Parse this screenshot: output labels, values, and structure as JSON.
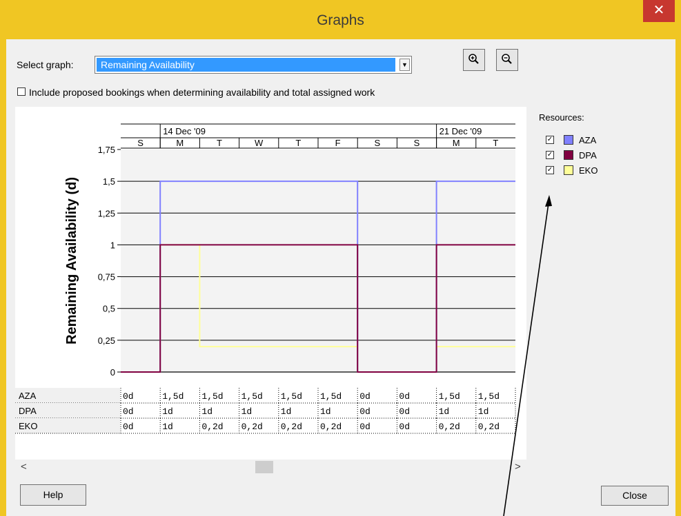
{
  "window": {
    "title": "Graphs",
    "close_glyph": "✕"
  },
  "toolbar": {
    "select_label": "Select graph:",
    "selected_graph": "Remaining Availability",
    "zoom_in_icon": "zoom-in-icon",
    "zoom_out_icon": "zoom-out-icon"
  },
  "options": {
    "include_proposed_label": "Include proposed bookings when determining availability and total assigned work",
    "include_proposed_checked": false
  },
  "timescale": {
    "weeks": [
      "14 Dec '09",
      "21 Dec '09"
    ],
    "days": [
      "S",
      "M",
      "T",
      "W",
      "T",
      "F",
      "S",
      "S",
      "M",
      "T"
    ]
  },
  "chart_data": {
    "type": "line",
    "ylabel": "Remaining Availability (d)",
    "yticks": [
      "1,75",
      "1,5",
      "1,25",
      "1",
      "0,75",
      "0,5",
      "0,25",
      "0"
    ],
    "ylim": [
      0,
      1.75
    ],
    "x": [
      "S",
      "M",
      "T",
      "W",
      "T",
      "F",
      "S",
      "S",
      "M",
      "T"
    ],
    "series": [
      {
        "name": "AZA",
        "color": "#8080ff",
        "values": [
          0,
          1.5,
          1.5,
          1.5,
          1.5,
          1.5,
          0,
          0,
          1.5,
          1.5
        ]
      },
      {
        "name": "DPA",
        "color": "#800040",
        "values": [
          0,
          1,
          1,
          1,
          1,
          1,
          0,
          0,
          1,
          1
        ]
      },
      {
        "name": "EKO",
        "color": "#ffff99",
        "values": [
          0,
          1,
          0.2,
          0.2,
          0.2,
          0.2,
          0,
          0,
          0.2,
          0.2
        ]
      }
    ]
  },
  "table": {
    "rows": [
      {
        "resource": "AZA",
        "cells": [
          "0d",
          "1,5d",
          "1,5d",
          "1,5d",
          "1,5d",
          "1,5d",
          "0d",
          "0d",
          "1,5d",
          "1,5d"
        ]
      },
      {
        "resource": "DPA",
        "cells": [
          "0d",
          "1d",
          "1d",
          "1d",
          "1d",
          "1d",
          "0d",
          "0d",
          "1d",
          "1d"
        ]
      },
      {
        "resource": "EKO",
        "cells": [
          "0d",
          "1d",
          "0,2d",
          "0,2d",
          "0,2d",
          "0,2d",
          "0d",
          "0d",
          "0,2d",
          "0,2d"
        ]
      }
    ]
  },
  "resources": {
    "heading": "Resources:",
    "items": [
      {
        "name": "AZA",
        "color": "#8080ff",
        "checked": true
      },
      {
        "name": "DPA",
        "color": "#800040",
        "checked": true
      },
      {
        "name": "EKO",
        "color": "#ffff99",
        "checked": true
      }
    ]
  },
  "scroll": {
    "left_glyph": "<",
    "right_glyph": ">"
  },
  "footer": {
    "help_label": "Help",
    "close_label": "Close"
  }
}
